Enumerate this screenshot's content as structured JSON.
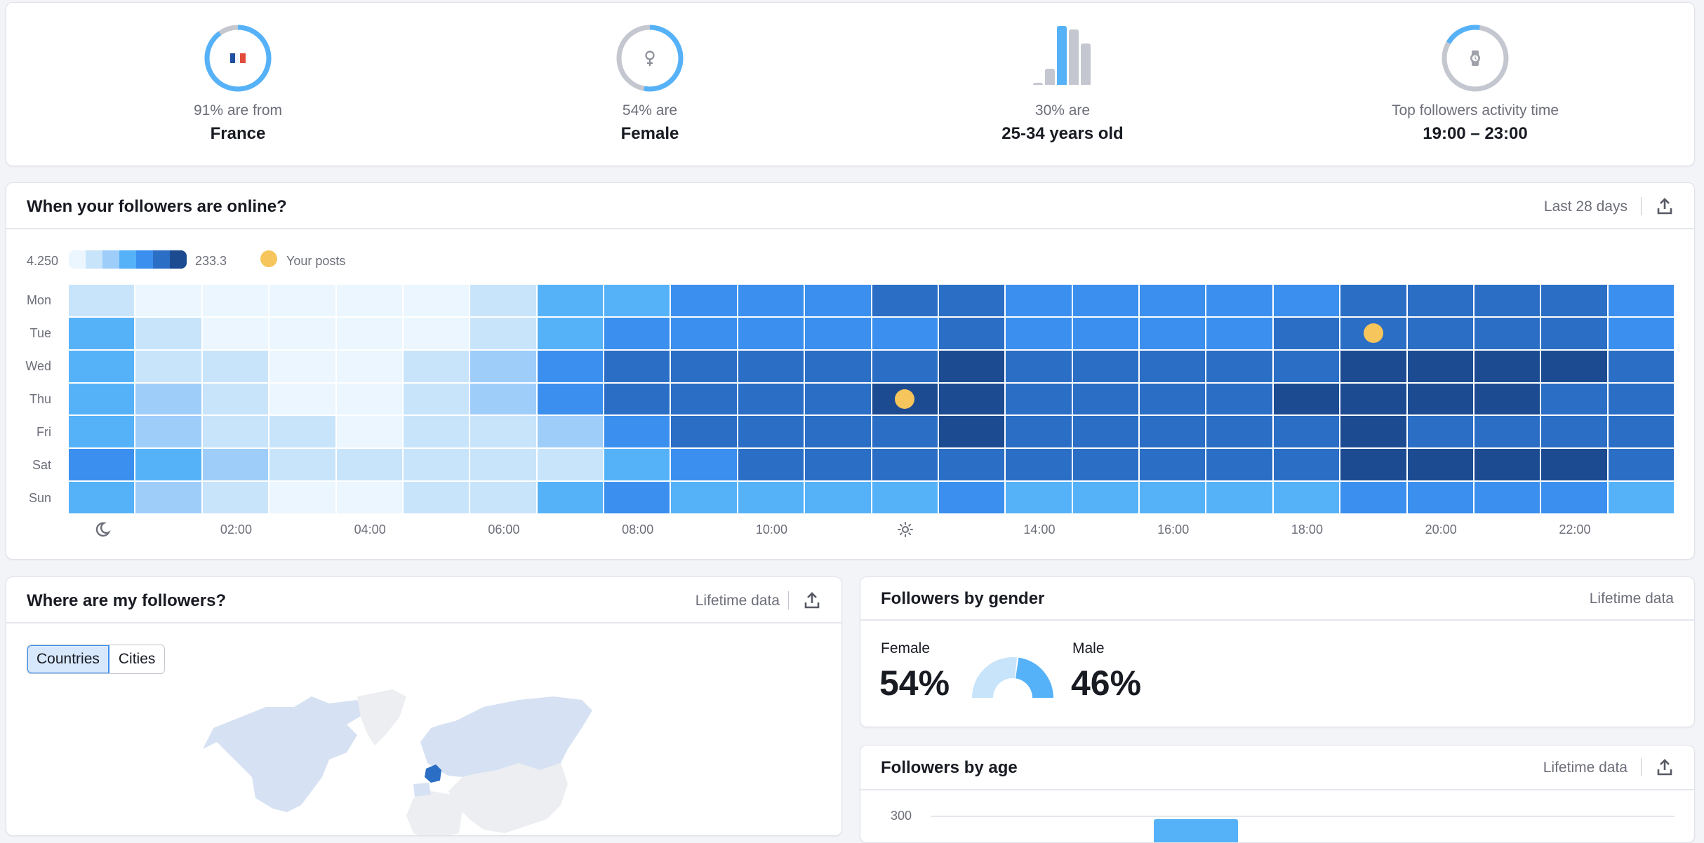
{
  "summary": {
    "country": {
      "caption": "91% are from",
      "value": "France",
      "percent": 91,
      "icon": "france-flag-icon"
    },
    "gender": {
      "caption": "54% are",
      "value": "Female",
      "percent": 54,
      "icon": "female-icon"
    },
    "age": {
      "caption": "30% are",
      "value": "25-34 years old",
      "percent": 30,
      "icon": "age-bars-icon",
      "bar_relative_heights": [
        0.04,
        0.27,
        1.0,
        0.94,
        0.7
      ],
      "highlighted_bar": 2
    },
    "activity": {
      "caption": "Top followers activity time",
      "value": "19:00 – 23:00",
      "icon": "watch-icon",
      "ring_fraction": 0.2
    }
  },
  "heatmap_card": {
    "title": "When your followers are online?",
    "period": "Last 28 days",
    "export_icon": "export-icon",
    "legend": {
      "min": "4.250",
      "max": "233.3",
      "posts_label": "Your posts"
    },
    "colors": [
      "#ebf6fe",
      "#c8e4fa",
      "#9ecdfa",
      "#56b2f8",
      "#3b8fee",
      "#2b6ec5",
      "#1c4b91"
    ],
    "post_color": "#f6c55b",
    "days": [
      "Mon",
      "Tue",
      "Wed",
      "Thu",
      "Fri",
      "Sat",
      "Sun"
    ],
    "hour_ticks": [
      {
        "hour": 0,
        "label": "",
        "icon": "moon-icon"
      },
      {
        "hour": 2,
        "label": "02:00"
      },
      {
        "hour": 4,
        "label": "04:00"
      },
      {
        "hour": 6,
        "label": "06:00"
      },
      {
        "hour": 8,
        "label": "08:00"
      },
      {
        "hour": 10,
        "label": "10:00"
      },
      {
        "hour": 12,
        "label": "",
        "icon": "sun-icon"
      },
      {
        "hour": 14,
        "label": "14:00"
      },
      {
        "hour": 16,
        "label": "16:00"
      },
      {
        "hour": 18,
        "label": "18:00"
      },
      {
        "hour": 20,
        "label": "20:00"
      },
      {
        "hour": 22,
        "label": "22:00"
      }
    ],
    "levels": [
      [
        1,
        0,
        0,
        0,
        0,
        0,
        1,
        3,
        3,
        4,
        4,
        4,
        5,
        5,
        4,
        4,
        4,
        4,
        4,
        5,
        5,
        5,
        5,
        4
      ],
      [
        3,
        1,
        0,
        0,
        0,
        0,
        1,
        3,
        4,
        4,
        4,
        4,
        4,
        5,
        4,
        4,
        4,
        4,
        5,
        5,
        5,
        5,
        5,
        4
      ],
      [
        3,
        1,
        1,
        0,
        0,
        1,
        2,
        4,
        5,
        5,
        5,
        5,
        5,
        6,
        5,
        5,
        5,
        5,
        5,
        6,
        6,
        6,
        6,
        5
      ],
      [
        3,
        2,
        1,
        0,
        0,
        1,
        2,
        4,
        5,
        5,
        5,
        5,
        6,
        6,
        5,
        5,
        5,
        5,
        6,
        6,
        6,
        6,
        5,
        5
      ],
      [
        3,
        2,
        1,
        1,
        0,
        1,
        1,
        2,
        4,
        5,
        5,
        5,
        5,
        6,
        5,
        5,
        5,
        5,
        5,
        6,
        5,
        5,
        5,
        5
      ],
      [
        4,
        3,
        2,
        1,
        1,
        1,
        1,
        1,
        3,
        4,
        5,
        5,
        5,
        5,
        5,
        5,
        5,
        5,
        5,
        6,
        6,
        6,
        6,
        5
      ],
      [
        3,
        2,
        1,
        0,
        0,
        1,
        1,
        3,
        4,
        3,
        3,
        3,
        3,
        4,
        3,
        3,
        3,
        3,
        3,
        4,
        4,
        4,
        4,
        3
      ]
    ],
    "posts": [
      {
        "day": 3,
        "hour": 12
      },
      {
        "day": 1,
        "hour": 19
      }
    ]
  },
  "map_card": {
    "title": "Where are my followers?",
    "period": "Lifetime data",
    "tabs": [
      {
        "label": "Countries",
        "active": true
      },
      {
        "label": "Cities",
        "active": false
      }
    ],
    "highlight_country": "France",
    "colors": {
      "highlight": "#2b6ec5",
      "has_followers": "#d6e2f3",
      "none": "#eceef1"
    }
  },
  "gender_card": {
    "title": "Followers by gender",
    "period": "Lifetime data",
    "female": {
      "label": "Female",
      "value": "54%",
      "percent": 54,
      "color": "#c8e4fa"
    },
    "male": {
      "label": "Male",
      "value": "46%",
      "percent": 46,
      "color": "#56b2f8"
    }
  },
  "age_card": {
    "title": "Followers by age",
    "period": "Lifetime data",
    "y_tick_top": "300"
  }
}
